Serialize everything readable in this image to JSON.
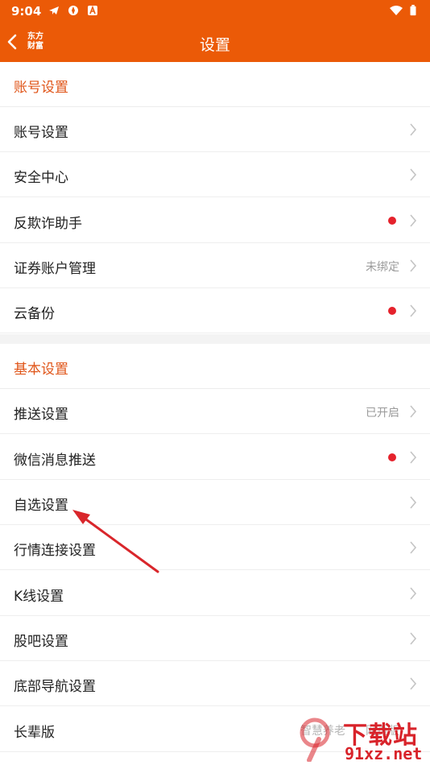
{
  "status_bar": {
    "time": "9:04"
  },
  "header": {
    "back_icon": "chevron-left-icon",
    "brand_line1": "东方",
    "brand_line2": "财富",
    "title": "设置"
  },
  "sections": [
    {
      "title": "账号设置",
      "items": [
        {
          "label": "账号设置",
          "value": "",
          "dot": false
        },
        {
          "label": "安全中心",
          "value": "",
          "dot": false
        },
        {
          "label": "反欺诈助手",
          "value": "",
          "dot": true
        },
        {
          "label": "证券账户管理",
          "value": "未绑定",
          "dot": false
        },
        {
          "label": "云备份",
          "value": "",
          "dot": true
        }
      ]
    },
    {
      "title": "基本设置",
      "items": [
        {
          "label": "推送设置",
          "value": "已开启",
          "dot": false
        },
        {
          "label": "微信消息推送",
          "value": "",
          "dot": true
        },
        {
          "label": "自选设置",
          "value": "",
          "dot": false
        },
        {
          "label": "行情连接设置",
          "value": "",
          "dot": false
        },
        {
          "label": "K线设置",
          "value": "",
          "dot": false
        },
        {
          "label": "股吧设置",
          "value": "",
          "dot": false
        },
        {
          "label": "底部导航设置",
          "value": "",
          "dot": false
        },
        {
          "label": "长辈版",
          "value": "智慧养老",
          "value_extra": "网页版",
          "dot": false
        }
      ]
    }
  ],
  "watermark": {
    "title": "下载站",
    "url": "91xz.net"
  },
  "colors": {
    "accent": "#EB5A07",
    "section_title": "#E0561A",
    "dot": "#E5222C",
    "arrow": "#D9262B"
  }
}
